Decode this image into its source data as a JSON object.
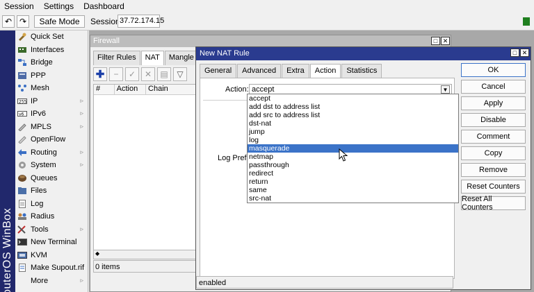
{
  "menubar": {
    "items": [
      "Session",
      "Settings",
      "Dashboard"
    ]
  },
  "toolbar": {
    "undo_icon": "undo-icon",
    "redo_icon": "redo-icon",
    "safe_mode_label": "Safe Mode",
    "session_label": "Session:",
    "session_value": "37.72.174.15",
    "status_color": "#1f7f1f"
  },
  "brand": {
    "text": "RouterOS WinBox"
  },
  "sidebar": {
    "items": [
      {
        "label": "Quick Set",
        "icon": "quick-set-icon",
        "submenu": false
      },
      {
        "label": "Interfaces",
        "icon": "interfaces-icon",
        "submenu": false
      },
      {
        "label": "Bridge",
        "icon": "bridge-icon",
        "submenu": false
      },
      {
        "label": "PPP",
        "icon": "ppp-icon",
        "submenu": false
      },
      {
        "label": "Mesh",
        "icon": "mesh-icon",
        "submenu": false
      },
      {
        "label": "IP",
        "icon": "ip-icon",
        "submenu": true
      },
      {
        "label": "IPv6",
        "icon": "ipv6-icon",
        "submenu": true
      },
      {
        "label": "MPLS",
        "icon": "mpls-icon",
        "submenu": true
      },
      {
        "label": "OpenFlow",
        "icon": "openflow-icon",
        "submenu": false
      },
      {
        "label": "Routing",
        "icon": "routing-icon",
        "submenu": true
      },
      {
        "label": "System",
        "icon": "system-icon",
        "submenu": true
      },
      {
        "label": "Queues",
        "icon": "queues-icon",
        "submenu": false
      },
      {
        "label": "Files",
        "icon": "files-icon",
        "submenu": false
      },
      {
        "label": "Log",
        "icon": "log-icon",
        "submenu": false
      },
      {
        "label": "Radius",
        "icon": "radius-icon",
        "submenu": false
      },
      {
        "label": "Tools",
        "icon": "tools-icon",
        "submenu": true
      },
      {
        "label": "New Terminal",
        "icon": "terminal-icon",
        "submenu": false
      },
      {
        "label": "KVM",
        "icon": "kvm-icon",
        "submenu": false
      },
      {
        "label": "Make Supout.rif",
        "icon": "supout-icon",
        "submenu": false
      },
      {
        "label": "More",
        "icon": "",
        "submenu": true
      }
    ]
  },
  "firewall": {
    "title": "Firewall",
    "tabs": [
      "Filter Rules",
      "NAT",
      "Mangle"
    ],
    "active_tab": "NAT",
    "columns": [
      "#",
      "Action",
      "Chain"
    ],
    "item_count": "0 items"
  },
  "nat_rule": {
    "title": "New NAT Rule",
    "tabs": [
      "General",
      "Advanced",
      "Extra",
      "Action",
      "Statistics"
    ],
    "active_tab": "Action",
    "action_label": "Action:",
    "action_value": "accept",
    "log_prefix_label": "Log Prefix:",
    "status": "enabled",
    "dropdown_options": [
      "accept",
      "add dst to address list",
      "add src to address list",
      "dst-nat",
      "jump",
      "log",
      "masquerade",
      "netmap",
      "passthrough",
      "redirect",
      "return",
      "same",
      "src-nat"
    ],
    "highlighted_option": "masquerade",
    "buttons": {
      "ok": "OK",
      "cancel": "Cancel",
      "apply": "Apply",
      "disable": "Disable",
      "comment": "Comment",
      "copy": "Copy",
      "remove": "Remove",
      "reset_counters": "Reset Counters",
      "reset_all_counters": "Reset All Counters"
    }
  }
}
